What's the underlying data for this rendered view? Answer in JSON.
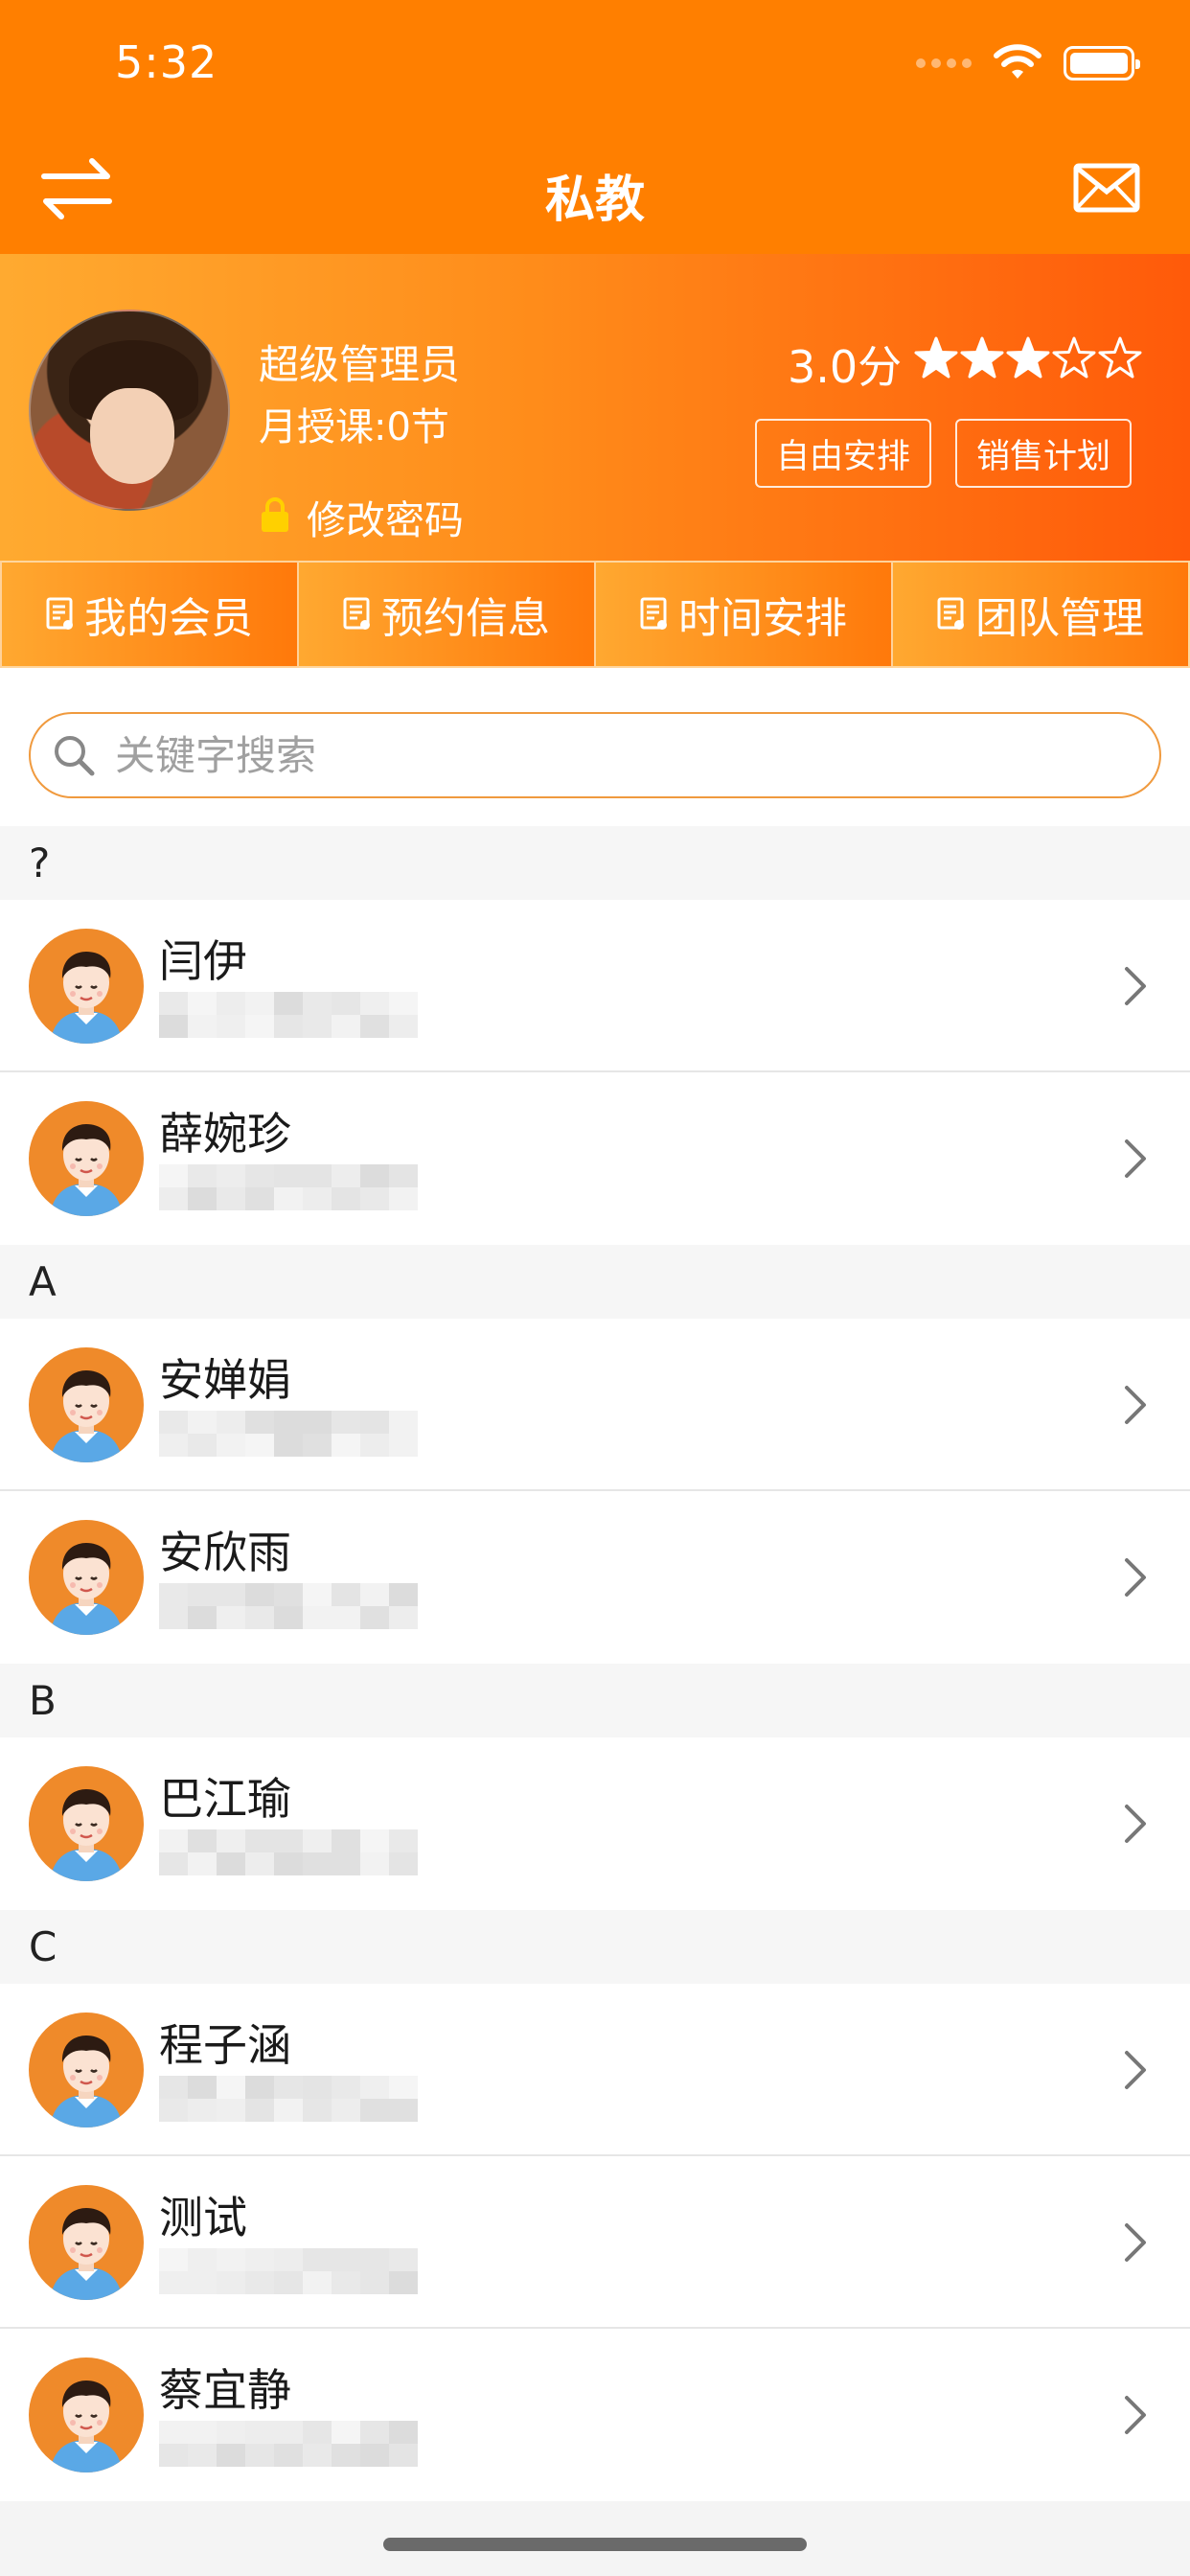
{
  "status_bar": {
    "time": "5:32"
  },
  "nav": {
    "title": "私教",
    "left_icon": "swap-arrows-icon",
    "right_icon": "mail-icon"
  },
  "profile": {
    "name": "超级管理员",
    "lessons": "月授课:0节",
    "change_password": "修改密码",
    "score": "3.0分",
    "rating": 3,
    "rating_max": 5,
    "btn_free_schedule": "自由安排",
    "btn_sales_plan": "销售计划"
  },
  "tabs": [
    "我的会员",
    "预约信息",
    "时间安排",
    "团队管理"
  ],
  "search": {
    "placeholder": "关键字搜索"
  },
  "sections": [
    {
      "letter": "?",
      "members": [
        {
          "name": "闫伊"
        },
        {
          "name": "薛婉珍"
        }
      ]
    },
    {
      "letter": "A",
      "members": [
        {
          "name": "安婵娟"
        },
        {
          "name": "安欣雨"
        }
      ]
    },
    {
      "letter": "B",
      "members": [
        {
          "name": "巴江瑜"
        }
      ]
    },
    {
      "letter": "C",
      "members": [
        {
          "name": "程子涵"
        },
        {
          "name": "测试"
        },
        {
          "name": "蔡宜静"
        }
      ]
    }
  ],
  "colors": {
    "primary": "#ff7f00",
    "accent": "#ef8a2a"
  }
}
